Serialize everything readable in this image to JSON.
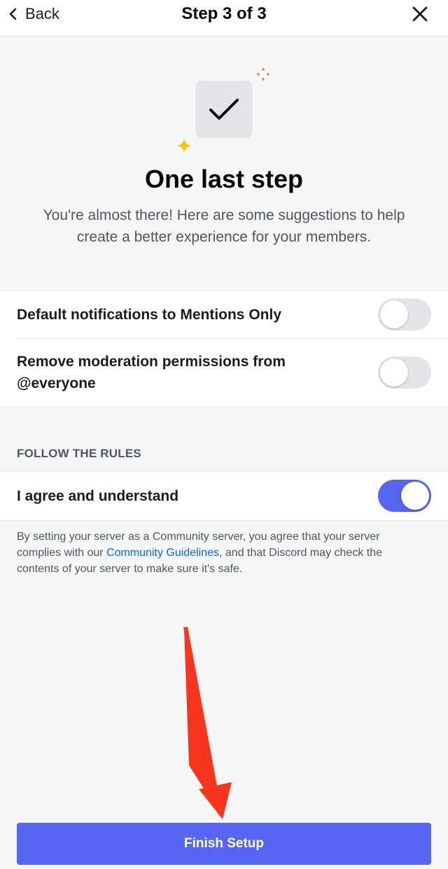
{
  "header": {
    "back_label": "Back",
    "title": "Step 3 of 3",
    "back_icon": "chevron-left-icon",
    "close_icon": "close-icon"
  },
  "hero": {
    "icon": "checkmark-icon",
    "title": "One last step",
    "subtitle": "You're almost there! Here are some suggestions to help create a better experience for your members."
  },
  "suggestions": [
    {
      "label": "Default notifications to Mentions Only",
      "enabled": false
    },
    {
      "label": "Remove moderation permissions from @everyone",
      "enabled": false
    }
  ],
  "rules": {
    "section_title": "FOLLOW THE RULES",
    "agree_label": "I agree and understand",
    "agree_enabled": true,
    "disclaimer_before": "By setting your server as a Community server, you agree that your server complies with our ",
    "disclaimer_link": "Community Guidelines",
    "disclaimer_after": ", and that Discord may check the contents of your server to make sure it's safe."
  },
  "finish_label": "Finish Setup",
  "colors": {
    "accent": "#5865f2",
    "link": "#006ce7",
    "annotation_arrow": "#f8361f",
    "sparkle_red": "#f06d5b",
    "sparkle_yellow": "#f5c400"
  }
}
